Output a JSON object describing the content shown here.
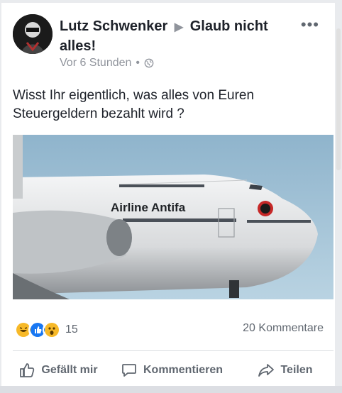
{
  "post": {
    "author": "Lutz Schwenker",
    "group": "Glaub nicht alles!",
    "timestamp": "Vor 6 Stunden",
    "separator": "•",
    "text": "Wisst Ihr eigentlich, was alles von Euren Steuergeldern bezahlt wird ?",
    "image_text": "Airline Antifa",
    "more_label": "•••"
  },
  "stats": {
    "reaction_count": "15",
    "comments": "20 Kommentare",
    "reactions": [
      "haha",
      "like",
      "wow"
    ]
  },
  "actions": [
    {
      "icon": "thumbs-up-icon",
      "label": "Gefällt mir"
    },
    {
      "icon": "comment-icon",
      "label": "Kommentieren"
    },
    {
      "icon": "share-icon",
      "label": "Teilen"
    }
  ],
  "colors": {
    "link": "#1d2129",
    "muted": "#90949c",
    "like_blue": "#1877f2",
    "haha_yellow": "#f7b928"
  }
}
